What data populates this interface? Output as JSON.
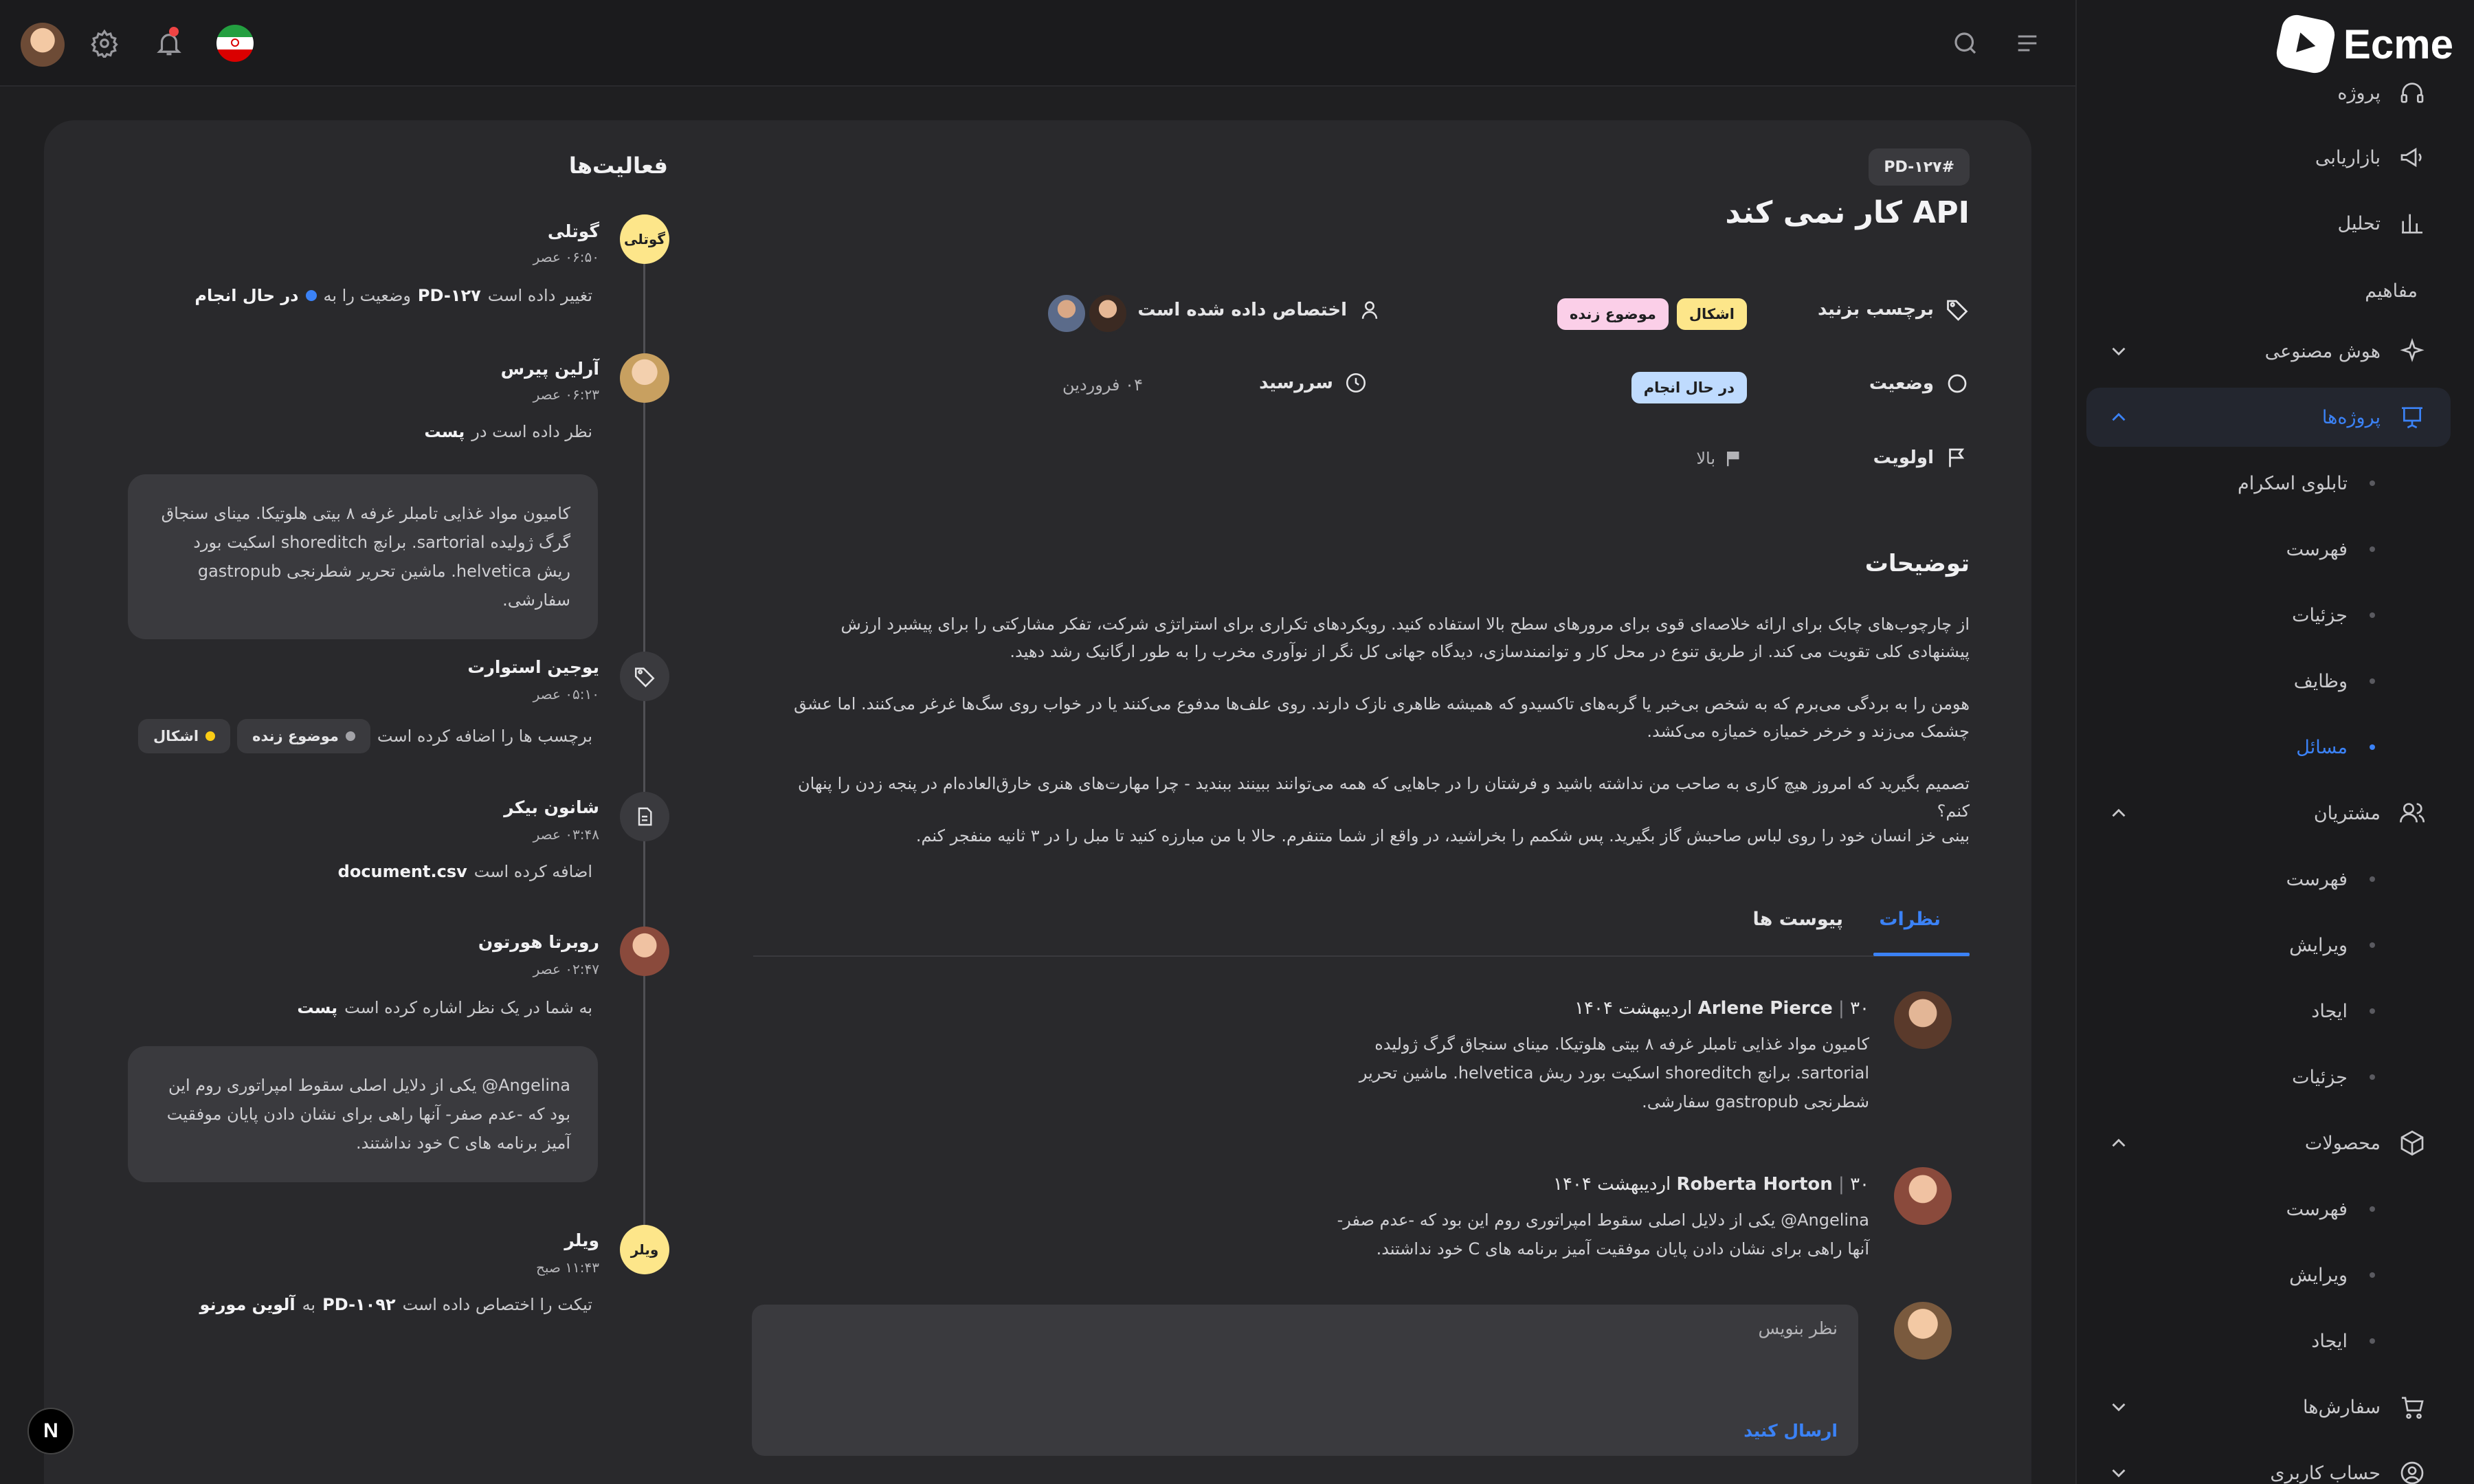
{
  "brand": {
    "name": "Ecme"
  },
  "sidebar": {
    "items": [
      {
        "label": "پروژه",
        "icon": "headset-icon"
      },
      {
        "label": "بازاریابی",
        "icon": "megaphone-icon"
      },
      {
        "label": "تحلیل",
        "icon": "bar-chart-icon"
      }
    ],
    "section_concepts": "مفاهیم",
    "ai": {
      "label": "هوش مصنوعی",
      "icon": "sparkle-icon"
    },
    "projects": {
      "label": "پروژه‌ها",
      "icon": "presentation-icon"
    },
    "projects_sub": [
      "تابلوی اسکرام",
      "فهرست",
      "جزئیات",
      "وظایف",
      "مسائل"
    ],
    "customers": {
      "label": "مشتریان",
      "icon": "users-icon"
    },
    "customers_sub": [
      "فهرست",
      "ویرایش",
      "ایجاد",
      "جزئیات"
    ],
    "products": {
      "label": "محصولات",
      "icon": "box-icon"
    },
    "products_sub": [
      "فهرست",
      "ویرایش",
      "ایجاد"
    ],
    "orders": {
      "label": "سفارش‌ها",
      "icon": "cart-icon"
    },
    "account": {
      "label": "حساب کاربری",
      "icon": "user-circle-icon"
    }
  },
  "ticket": {
    "id": "#PD-۱۲۷",
    "title": "API کار نمی کند",
    "labels_label": "برچسب بزنید",
    "tags": [
      "اشکال",
      "موضوع زنده"
    ],
    "assigned_label": "اختصاص داده شده است",
    "status_label": "وضعیت",
    "status_value": "در حال انجام",
    "due_label": "سررسید",
    "due_value": "۰۴ فروردین",
    "priority_label": "اولویت",
    "priority_value": "بالا"
  },
  "description": {
    "title": "توضیحات",
    "paragraphs": [
      "از چارچوب‌های چابک برای ارائه خلاصه‌ای قوی برای مرورهای سطح بالا استفاده کنید. رویکردهای تکراری برای استراتژی شرکت، تفکر مشارکتی را برای پیشبرد ارزش پیشنهادی کلی تقویت می کند. از طریق تنوع در محل کار و توانمندسازی، دیدگاه جهانی کل نگر از نوآوری مخرب را به طور ارگانیک رشد دهید.",
      "هومن را به بردگی می‌برم که به شخص بی‌خبر یا گربه‌های تاکسیدو که همیشه ظاهری نازک دارند. روی علف‌ها مدفوع می‌کنند یا در خواب روی سگ‌ها غرغر می‌کنند. اما عشق چشمک می‌زند و خرخر خمیازه خمیازه می‌کشد.",
      "تصمیم بگیرید که امروز هیچ کاری به صاحب من نداشته باشید و فرشتان را در جاهایی که همه می‌توانند ببینند ببندید - چرا مهارت‌های هنری خارق‌العاده‌ام در پنجه زدن را پنهان کنم؟",
      "بینی خز انسان خود را روی لباس صاحبش گاز بگیرید. پس شکمم را بخراشید، در واقع از شما متنفرم. حالا با من مبارزه کنید تا مبل را در ۳ ثانیه منفجر کنم."
    ]
  },
  "tabs": {
    "comments": "نظرات",
    "attachments": "پیوست ها"
  },
  "comments": [
    {
      "author": "Arlene Pierce",
      "date": "۳۰ اردیبهشت ۱۴۰۴",
      "body": "کامیون مواد غذایی تامبلر غرفه ۸ بیتی هلوتیکا. مینای سنجاق گرگ ژولیده sartorial. برانچ shoreditch اسکیت بورد ریش helvetica. ماشین تحریر شطرنجی gastropub سفارشی."
    },
    {
      "author": "Roberta Horton",
      "date": "۳۰ اردیبهشت ۱۴۰۴",
      "body": "Angelina@ یکی از دلایل اصلی سقوط امپراتوری روم این بود که -عدم صفر- آنها راهی برای نشان دادن پایان موفقیت آمیز برنامه های C خود نداشتند."
    }
  ],
  "composer": {
    "placeholder": "نظر بنویس",
    "send": "ارسال کنید"
  },
  "activity": {
    "title": "فعالیت‌ها",
    "items": [
      {
        "name": "گوتلی",
        "avatar_text": "گوتلی",
        "time": "۰۶:۵۰ عصر",
        "text": "تغییر داده است",
        "ref": "PD-۱۲۷",
        "text2": "وضعیت را به",
        "value": "در حال انجام"
      },
      {
        "name": "آرلین پیرس",
        "time": "۰۶:۲۳ عصر",
        "text": "نظر داده است در",
        "ref": "پست",
        "box": "کامیون مواد غذایی تامبلر غرفه ۸ بیتی هلوتیکا. مینای سنجاق گرگ ژولیده sartorial. برانچ shoreditch اسکیت بورد ریش helvetica. ماشین تحریر شطرنجی gastropub سفارشی."
      },
      {
        "name": "یوجین استوارت",
        "time": "۰۵:۱۰ عصر",
        "text": "برچسب ها را اضافه کرده است",
        "tags": [
          "موضوع زنده",
          "اشکال"
        ]
      },
      {
        "name": "شانون بیکر",
        "time": "۰۳:۴۸ عصر",
        "text": "اضافه کرده است",
        "ref": "document.csv"
      },
      {
        "name": "روبرتا هورتون",
        "time": "۰۲:۴۷ عصر",
        "text": "به شما در یک نظر اشاره کرده است",
        "ref": "پست",
        "box": "Angelina@ یکی از دلایل اصلی سقوط امپراتوری روم این بود که -عدم صفر- آنها راهی برای نشان دادن پایان موفقیت آمیز برنامه های C خود نداشتند."
      },
      {
        "name": "ویلر",
        "avatar_text": "ویلر",
        "time": "۱۱:۴۳ صبح",
        "text": "تیکت را اختصاص داده است",
        "ref": "PD-۱۰۹۲",
        "text2": "به",
        "value": "آلوین مورنو"
      }
    ]
  },
  "colors": {
    "accent": "#3b82f6",
    "bg": "#1f1f21",
    "card": "#29292c"
  }
}
